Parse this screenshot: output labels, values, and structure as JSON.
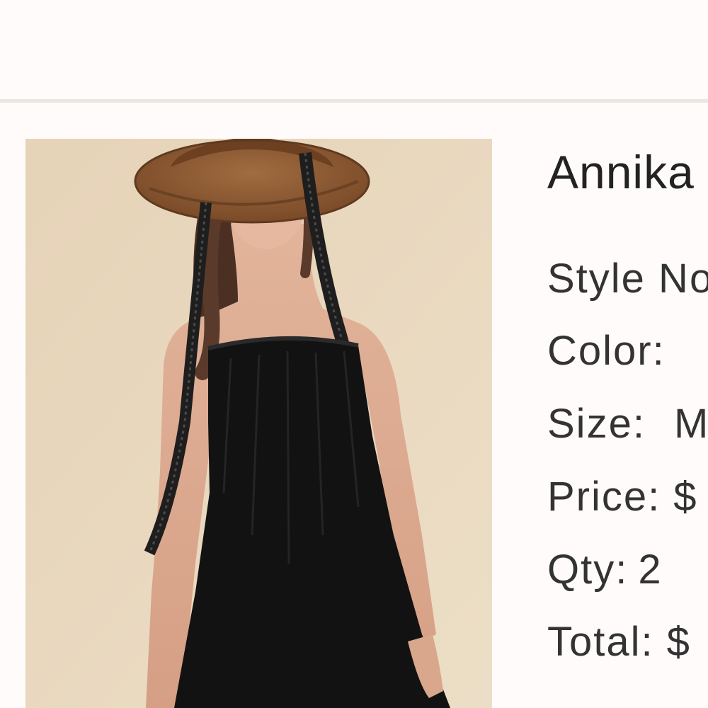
{
  "product": {
    "title": "Annika",
    "image_alt": "Model wearing black strapless jumpsuit and straw hat with black lace ribbons",
    "style_no_label": "Style No",
    "color_label": "Color:",
    "size_label": "Size:",
    "size_value": "M",
    "price_label": "Price:",
    "price_value": "$",
    "qty_label": "Qty:",
    "qty_value": "2",
    "total_label": "Total:",
    "total_value": "$"
  },
  "colors": {
    "page_bg": "#fefbfa",
    "divider": "#ebe6e2",
    "photo_bg": "#e8d9c0",
    "garment": "#121212",
    "hat": "#8b5a33"
  }
}
